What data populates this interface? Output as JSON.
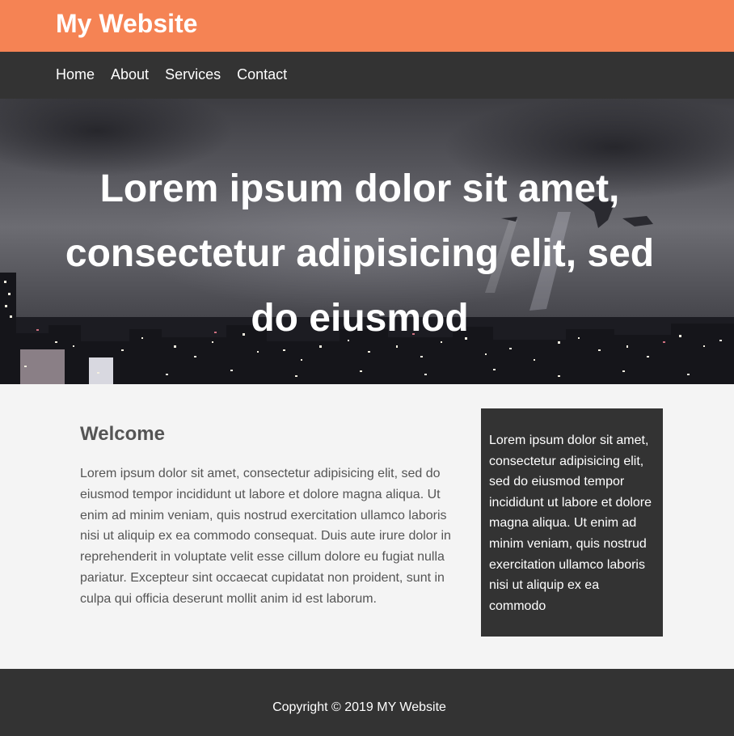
{
  "header": {
    "title": "My Website",
    "background_color": "#f58354"
  },
  "nav": {
    "items": [
      {
        "label": "Home"
      },
      {
        "label": "About"
      },
      {
        "label": "Services"
      },
      {
        "label": "Contact"
      }
    ],
    "background_color": "#333333"
  },
  "hero": {
    "heading": "Lorem ipsum dolor sit amet, consectetur adipisicing elit, sed do eiusmod",
    "image": "night-city-skyline-image"
  },
  "main": {
    "title": "Welcome",
    "text": "Lorem ipsum dolor sit amet, consectetur adipisicing elit, sed do eiusmod tempor incididunt ut labore et dolore magna aliqua. Ut enim ad minim veniam, quis nostrud exercitation ullamco laboris nisi ut aliquip ex ea commodo consequat. Duis aute irure dolor in reprehenderit in voluptate velit esse cillum dolore eu fugiat nulla pariatur. Excepteur sint occaecat cupidatat non proident, sunt in culpa qui officia deserunt mollit anim id est laborum."
  },
  "sidebar": {
    "text": "Lorem ipsum dolor sit amet, consectetur adipisicing elit, sed do eiusmod tempor incididunt ut labore et dolore magna aliqua. Ut enim ad minim veniam, quis nostrud exercitation ullamco laboris nisi ut aliquip ex ea commodo"
  },
  "footer": {
    "copyright": "Copyright © 2019 MY Website"
  }
}
